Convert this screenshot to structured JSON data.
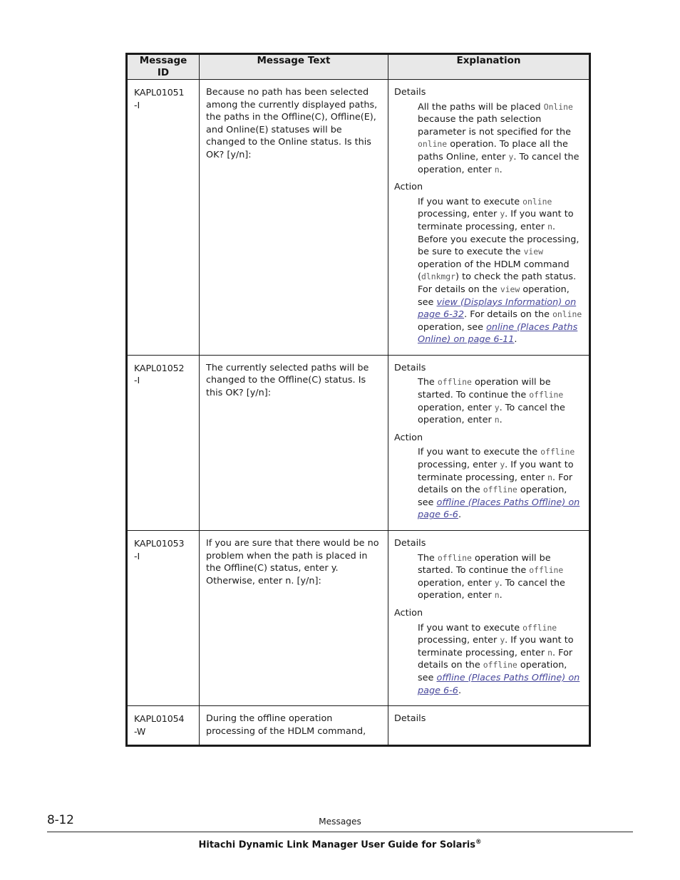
{
  "document": {
    "table": {
      "headers": [
        "Message\nID",
        "Message Text",
        "Explanation"
      ],
      "header_id_line1": "Message",
      "header_id_line2": "ID",
      "header_text": "Message Text",
      "header_explanation": "Explanation",
      "rows": [
        {
          "id_line1": "KAPL01051",
          "id_line2": "-I",
          "message_text": "Because no path has been selected among the currently displayed paths, the paths in the Offline(C), Offline(E), and Online(E) statuses will be changed to the Online status. Is this OK? [y/n]:",
          "details_label": "Details",
          "details_parts": [
            {
              "t": "All the paths will be placed ",
              "s": "plain"
            },
            {
              "t": "Online",
              "s": "code"
            },
            {
              "t": " because the path selection parameter is not specified for the ",
              "s": "plain"
            },
            {
              "t": "online",
              "s": "code"
            },
            {
              "t": " operation. To place all the paths Online, enter ",
              "s": "plain"
            },
            {
              "t": "y",
              "s": "code"
            },
            {
              "t": ". To cancel the operation, enter ",
              "s": "plain"
            },
            {
              "t": "n",
              "s": "code"
            },
            {
              "t": ".",
              "s": "plain"
            }
          ],
          "action_label": "Action",
          "action_parts": [
            {
              "t": "If you want to execute ",
              "s": "plain"
            },
            {
              "t": "online",
              "s": "code"
            },
            {
              "t": " processing, enter ",
              "s": "plain"
            },
            {
              "t": "y",
              "s": "code"
            },
            {
              "t": ". If you want to terminate processing, enter ",
              "s": "plain"
            },
            {
              "t": "n",
              "s": "code"
            },
            {
              "t": ". Before you execute the processing, be sure to execute the ",
              "s": "plain"
            },
            {
              "t": "view",
              "s": "code"
            },
            {
              "t": " operation of the HDLM command (",
              "s": "plain"
            },
            {
              "t": "dlnkmgr",
              "s": "code"
            },
            {
              "t": ") to check the path status. For details on the ",
              "s": "plain"
            },
            {
              "t": "view",
              "s": "code"
            },
            {
              "t": " operation, see ",
              "s": "plain"
            },
            {
              "t": "view (Displays Information) on page 6-32",
              "s": "link"
            },
            {
              "t": ". For details on the ",
              "s": "plain"
            },
            {
              "t": "online",
              "s": "code"
            },
            {
              "t": " operation, see ",
              "s": "plain"
            },
            {
              "t": "online (Places Paths Online) on page 6-11",
              "s": "link"
            },
            {
              "t": ".",
              "s": "plain"
            }
          ]
        },
        {
          "id_line1": "KAPL01052",
          "id_line2": "-I",
          "message_text": "The currently selected paths will be changed to the Offline(C) status. Is this OK? [y/n]:",
          "details_label": "Details",
          "details_parts": [
            {
              "t": "The ",
              "s": "plain"
            },
            {
              "t": "offline",
              "s": "code"
            },
            {
              "t": " operation will be started. To continue the ",
              "s": "plain"
            },
            {
              "t": "offline",
              "s": "code"
            },
            {
              "t": " operation, enter ",
              "s": "plain"
            },
            {
              "t": "y",
              "s": "code"
            },
            {
              "t": ". To cancel the operation, enter ",
              "s": "plain"
            },
            {
              "t": "n",
              "s": "code"
            },
            {
              "t": ".",
              "s": "plain"
            }
          ],
          "action_label": "Action",
          "action_parts": [
            {
              "t": "If you want to execute the ",
              "s": "plain"
            },
            {
              "t": "offline",
              "s": "code"
            },
            {
              "t": " processing, enter ",
              "s": "plain"
            },
            {
              "t": "y",
              "s": "code"
            },
            {
              "t": ". If you want to terminate processing, enter ",
              "s": "plain"
            },
            {
              "t": "n",
              "s": "code"
            },
            {
              "t": ". For details on the ",
              "s": "plain"
            },
            {
              "t": "offline",
              "s": "code"
            },
            {
              "t": " operation, see ",
              "s": "plain"
            },
            {
              "t": "offline (Places Paths Offline) on page 6-6",
              "s": "link"
            },
            {
              "t": ".",
              "s": "plain"
            }
          ]
        },
        {
          "id_line1": "KAPL01053",
          "id_line2": "-I",
          "message_text": "If you are sure that there would be no problem when the path is placed in the Offline(C) status, enter y. Otherwise, enter n. [y/n]:",
          "details_label": "Details",
          "details_parts": [
            {
              "t": "The ",
              "s": "plain"
            },
            {
              "t": "offline",
              "s": "code"
            },
            {
              "t": " operation will be started. To continue the ",
              "s": "plain"
            },
            {
              "t": "offline",
              "s": "code"
            },
            {
              "t": " operation, enter ",
              "s": "plain"
            },
            {
              "t": "y",
              "s": "code"
            },
            {
              "t": ". To cancel the operation, enter ",
              "s": "plain"
            },
            {
              "t": "n",
              "s": "code"
            },
            {
              "t": ".",
              "s": "plain"
            }
          ],
          "action_label": "Action",
          "action_parts": [
            {
              "t": "If you want to execute ",
              "s": "plain"
            },
            {
              "t": "offline",
              "s": "code"
            },
            {
              "t": " processing, enter ",
              "s": "plain"
            },
            {
              "t": "y",
              "s": "code"
            },
            {
              "t": ". If you want to terminate processing, enter ",
              "s": "plain"
            },
            {
              "t": "n",
              "s": "code"
            },
            {
              "t": ". For details on the ",
              "s": "plain"
            },
            {
              "t": "offline",
              "s": "code"
            },
            {
              "t": " operation, see ",
              "s": "plain"
            },
            {
              "t": "offline (Places Paths Offline) on page 6-6",
              "s": "link"
            },
            {
              "t": ".",
              "s": "plain"
            }
          ]
        },
        {
          "id_line1": "KAPL01054",
          "id_line2": "-W",
          "message_text": "During the offline operation processing of the HDLM command,",
          "details_label": "Details",
          "details_parts": [],
          "action_label": "",
          "action_parts": []
        }
      ]
    },
    "footer": {
      "folio": "8-12",
      "running_head": "Messages",
      "book_title": "Hitachi Dynamic Link Manager User Guide for Solaris",
      "book_title_superscript": "®"
    },
    "colors": {
      "link": "#47479b",
      "code_text": "#5a5a5a",
      "header_background": "#e8e8e8",
      "border": "#1b1b1b"
    }
  }
}
